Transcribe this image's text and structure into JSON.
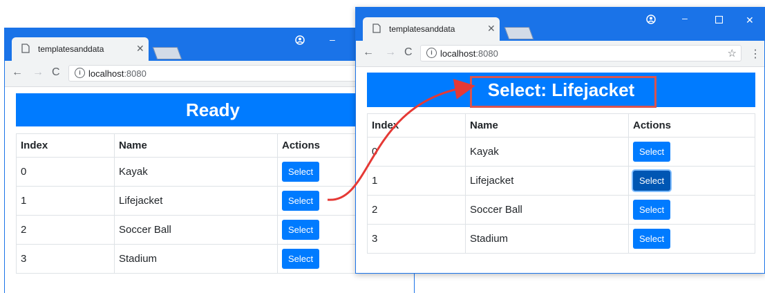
{
  "tab_title": "templatesanddata",
  "url_host": "localhost",
  "url_port": ":8080",
  "left_window": {
    "banner": "Ready",
    "headers": [
      "Index",
      "Name",
      "Actions"
    ],
    "rows": [
      {
        "index": "0",
        "name": "Kayak",
        "action": "Select"
      },
      {
        "index": "1",
        "name": "Lifejacket",
        "action": "Select"
      },
      {
        "index": "2",
        "name": "Soccer Ball",
        "action": "Select"
      },
      {
        "index": "3",
        "name": "Stadium",
        "action": "Select"
      }
    ]
  },
  "right_window": {
    "banner": "Select: Lifejacket",
    "headers": [
      "Index",
      "Name",
      "Actions"
    ],
    "rows": [
      {
        "index": "0",
        "name": "Kayak",
        "action": "Select"
      },
      {
        "index": "1",
        "name": "Lifejacket",
        "action": "Select"
      },
      {
        "index": "2",
        "name": "Soccer Ball",
        "action": "Select"
      },
      {
        "index": "3",
        "name": "Stadium",
        "action": "Select"
      }
    ]
  },
  "colors": {
    "chrome_blue": "#1a73e8",
    "banner_blue": "#007bff",
    "button_active": "#0056b3",
    "annotation_red": "#d9534f"
  }
}
